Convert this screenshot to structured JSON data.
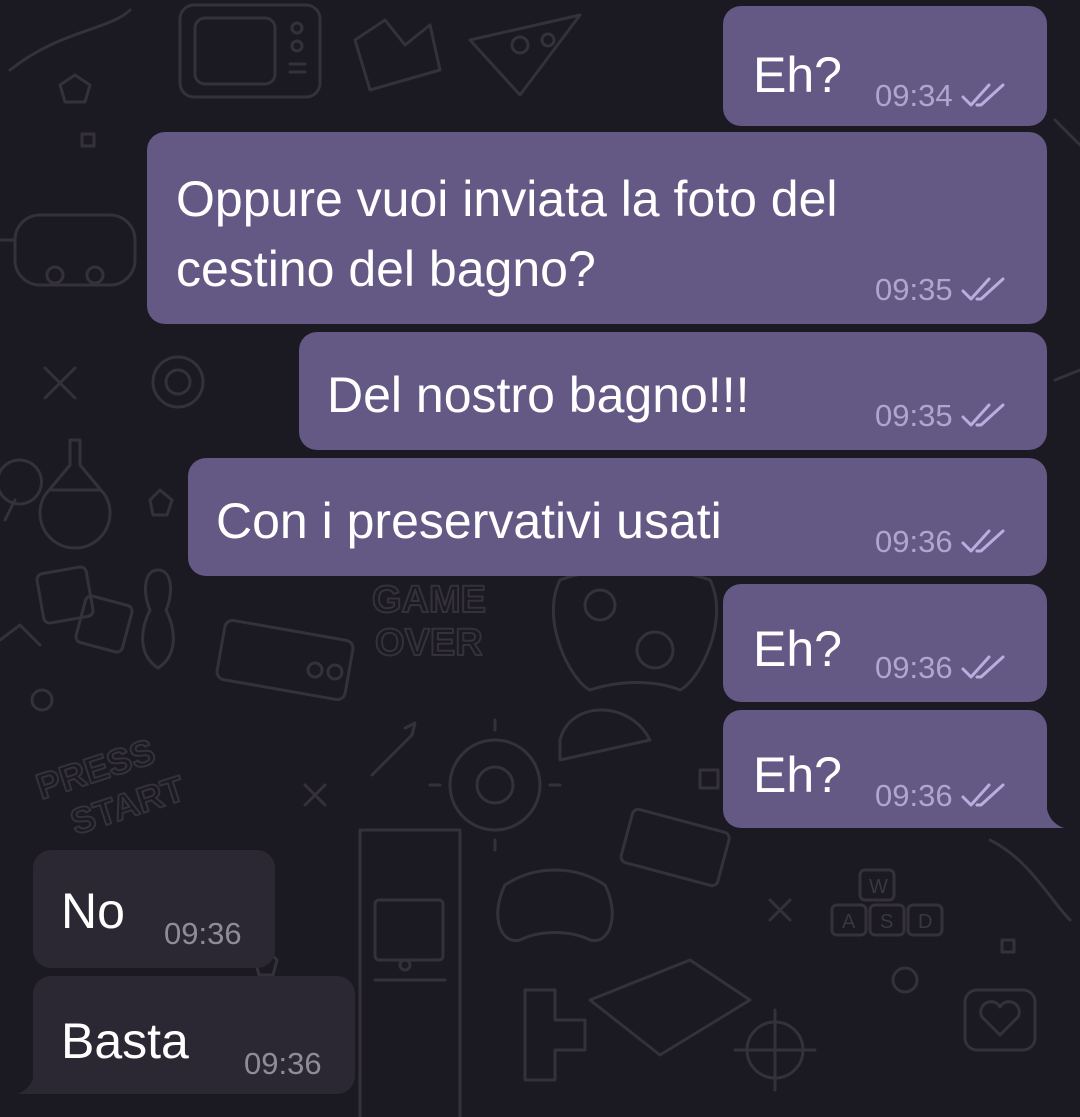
{
  "chat": {
    "messages": [
      {
        "text": "Eh?",
        "time": "09:34",
        "direction": "outgoing",
        "status": "read"
      },
      {
        "text": "Oppure vuoi inviata la foto del",
        "text_line2": "cestino del bagno?",
        "time": "09:35",
        "direction": "outgoing",
        "status": "read"
      },
      {
        "text": "Del nostro bagno!!!",
        "time": "09:35",
        "direction": "outgoing",
        "status": "read"
      },
      {
        "text": "Con i preservativi usati",
        "time": "09:36",
        "direction": "outgoing",
        "status": "read"
      },
      {
        "text": "Eh?",
        "time": "09:36",
        "direction": "outgoing",
        "status": "read"
      },
      {
        "text": "Eh?",
        "time": "09:36",
        "direction": "outgoing",
        "status": "read"
      },
      {
        "text": "No",
        "time": "09:36",
        "direction": "incoming"
      },
      {
        "text": "Basta",
        "time": "09:36",
        "direction": "incoming"
      }
    ]
  },
  "wallpaper": {
    "texts": [
      "GAME",
      "OVER",
      "PRESS",
      "START",
      "W",
      "A",
      "S",
      "D"
    ],
    "theme": "game-doodles"
  },
  "colors": {
    "background": "#1b1921",
    "outgoing_bubble": "#645885",
    "incoming_bubble": "#2b2833",
    "message_text": "#ffffff",
    "outgoing_meta": "#b0a6cd",
    "incoming_meta": "#8f8b99",
    "read_check": "#b9aee0"
  },
  "icons": {
    "read_receipt": "double-check-icon"
  }
}
